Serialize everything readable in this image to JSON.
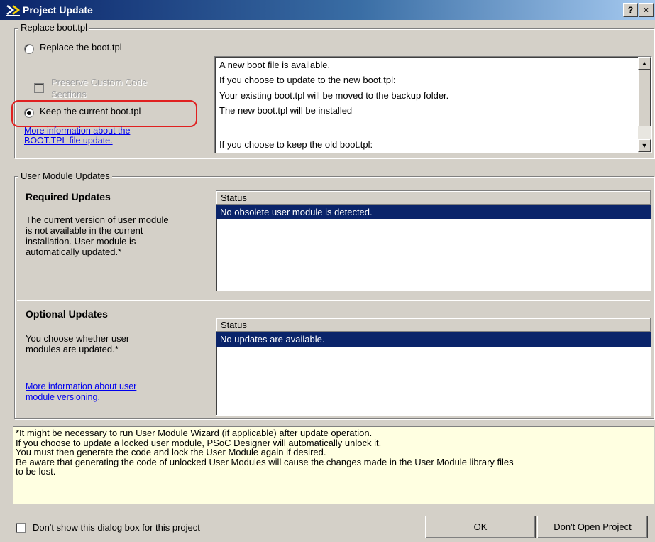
{
  "window": {
    "title": "Project Update",
    "help_button": "?",
    "close_button": "×"
  },
  "replace_group": {
    "legend": "Replace boot.tpl",
    "radio_replace": "Replace the boot.tpl",
    "checkbox_preserve_line1": "Preserve Custom Code",
    "checkbox_preserve_line2": "Sections",
    "radio_keep": "Keep the current boot.tpl",
    "selected": "keep",
    "link_line1": "More information about the",
    "link_line2": "BOOT.TPL file update.",
    "memo_lines": [
      "A new boot file is available.",
      "If you choose to update to the new boot.tpl:",
      "Your existing boot.tpl will be moved to the backup folder.",
      "The new boot.tpl will be installed",
      "",
      "If you choose to keep the old boot.tpl:"
    ]
  },
  "module_group": {
    "legend": "User Module Updates",
    "required": {
      "heading": "Required Updates",
      "desc_lines": [
        "The current version of user module",
        "is not available in the current",
        "installation.  User module is",
        "automatically updated.*"
      ],
      "column_header": "Status",
      "rows": [
        "No obsolete user module is detected."
      ]
    },
    "optional": {
      "heading": "Optional Updates",
      "desc_lines": [
        "You choose whether user",
        "modules are updated.*"
      ],
      "link_line1": "More information about user",
      "link_line2": "module versioning.",
      "column_header": "Status",
      "rows": [
        "No updates are available."
      ]
    }
  },
  "note_lines": [
    "*It might be necessary to run User Module Wizard (if applicable) after update operation.",
    "If you choose to update a locked user module, PSoC Designer will automatically unlock it.",
    "You must then generate the code and lock the User Module again if desired.",
    "Be aware that generating the code of unlocked User Modules will cause the changes made in the User Module library files",
    "to be lost."
  ],
  "footer": {
    "dont_show_label": "Don't show this dialog box for this project",
    "ok_button": "OK",
    "dont_open_button": "Don't Open Project"
  },
  "colors": {
    "highlight_box": "#e02020",
    "selection": "#0a246a",
    "note_background": "#ffffe1"
  }
}
